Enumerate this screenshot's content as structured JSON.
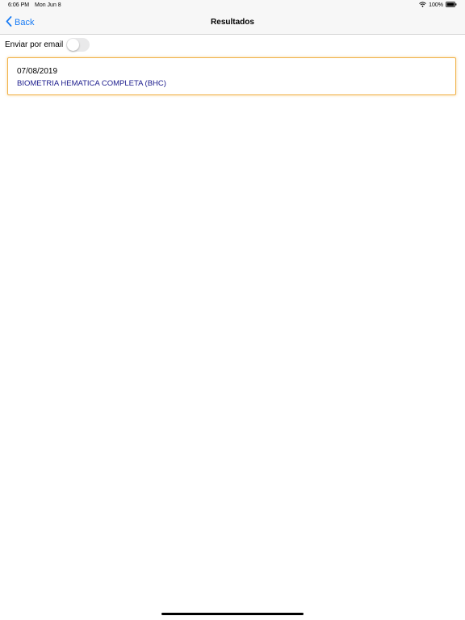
{
  "status_bar": {
    "time": "6:06 PM",
    "date": "Mon Jun 8",
    "battery": "100%",
    "wifi_icon": "wifi-icon",
    "battery_icon": "battery-icon"
  },
  "nav": {
    "back_label": "Back",
    "title": "Resultados",
    "back_icon": "chevron-left-icon"
  },
  "email": {
    "label": "Enviar por email",
    "toggle_on": false
  },
  "results": [
    {
      "date": "07/08/2019",
      "name": "BIOMETRIA HEMATICA COMPLETA (BHC)"
    }
  ],
  "colors": {
    "accent": "#1a7cf4",
    "card_border": "#f0b24a",
    "result_text": "#1a1a8c"
  }
}
